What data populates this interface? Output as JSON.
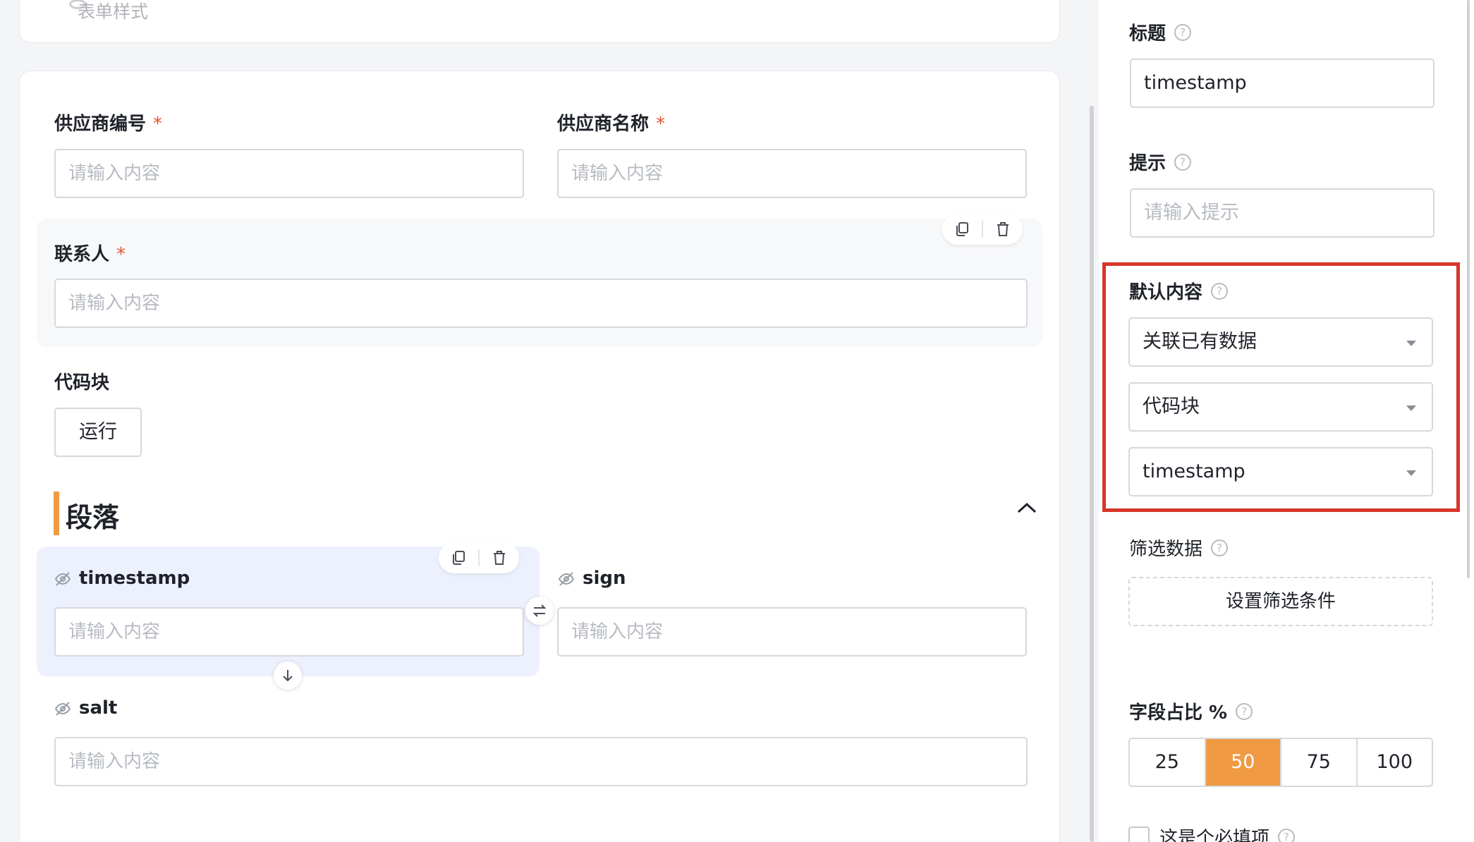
{
  "form": {
    "top_card_title": "表单样式",
    "supplier_code": {
      "label": "供应商编号",
      "required": "*",
      "placeholder": "请输入内容"
    },
    "supplier_name": {
      "label": "供应商名称",
      "required": "*",
      "placeholder": "请输入内容"
    },
    "contact": {
      "label": "联系人",
      "required": "*",
      "placeholder": "请输入内容"
    },
    "code_block": {
      "label": "代码块",
      "run_label": "运行"
    },
    "paragraph": {
      "title": "段落"
    },
    "timestamp": {
      "label": "timestamp",
      "placeholder": "请输入内容"
    },
    "sign": {
      "label": "sign",
      "placeholder": "请输入内容"
    },
    "salt": {
      "label": "salt",
      "placeholder": "请输入内容"
    }
  },
  "panel": {
    "title": {
      "label": "标题",
      "value": "timestamp"
    },
    "hint": {
      "label": "提示",
      "placeholder": "请输入提示"
    },
    "default_content": {
      "label": "默认内容",
      "source_select": "关联已有数据",
      "block_select": "代码块",
      "field_select": "timestamp"
    },
    "filter": {
      "label": "筛选数据",
      "button": "设置筛选条件"
    },
    "width_ratio": {
      "label": "字段占比 %",
      "options": [
        "25",
        "50",
        "75",
        "100"
      ],
      "selected": "50"
    },
    "required": {
      "label": "这是个必填项"
    },
    "help_glyph": "?"
  },
  "colors": {
    "accent": "#f09a44",
    "highlight_frame": "#d9362b",
    "required_star": "#e5532d"
  }
}
